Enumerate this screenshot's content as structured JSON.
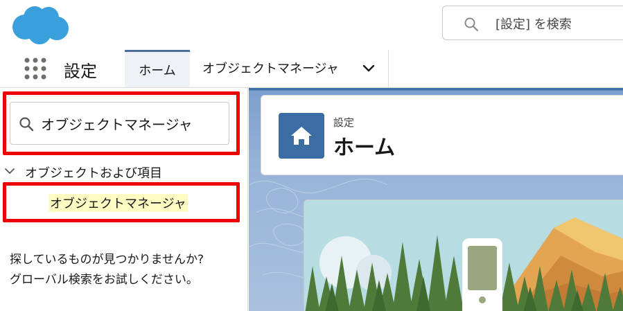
{
  "header": {
    "logo_icon": "salesforce-cloud-logo",
    "search_placeholder": "[設定] を検索",
    "search_icon": "search-icon"
  },
  "nav": {
    "app_launcher_icon": "app-launcher-grid-icon",
    "app_name": "設定",
    "tabs": [
      {
        "label": "ホーム",
        "active": true
      },
      {
        "label": "オブジェクトマネージャ",
        "active": false,
        "has_dropdown": true
      }
    ]
  },
  "sidebar": {
    "quick_find_value": "オブジェクトマネージャ",
    "tree": {
      "section_label": "オブジェクトおよび項目",
      "expanded": true,
      "items": [
        {
          "label": "オブジェクトマネージャ",
          "highlighted": true
        }
      ]
    },
    "help_text_line1": "探しているものが見つかりませんか?",
    "help_text_line2": "グローバル検索をお試しください。"
  },
  "main": {
    "header": {
      "breadcrumb": "設定",
      "title": "ホーム",
      "icon": "home-icon"
    },
    "hero_illustration": "mountain-forest-phone-illustration"
  },
  "colors": {
    "brand_cloud": "#1b96ff",
    "annotation_red": "#ee0000",
    "home_tile": "#3b6da3",
    "highlight_yellow": "#fdfdc3"
  }
}
